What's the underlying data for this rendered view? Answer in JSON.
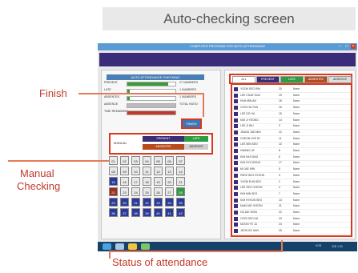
{
  "banner": {
    "title": "Auto-checking screen"
  },
  "annotations": {
    "finish": "Finish",
    "manual_line1": "Manual",
    "manual_line2": "Checking",
    "status": "Status of attendance"
  },
  "app": {
    "window_title": "COMPUTER PROGRAM FOR AUTO-ATTENDANCE",
    "left_panel_title": "AUTO ATTENDANCE CHECKING",
    "stats": [
      {
        "label": "PRESENT",
        "progress": 0.85,
        "value": "27 NUMBERS",
        "color": "#3a9c3a"
      },
      {
        "label": "LATE",
        "progress": 0.05,
        "value": "1 NUMBERS",
        "color": "#3a9c3a"
      },
      {
        "label": "ABSENTEE",
        "progress": 0.05,
        "value": "1 NUMBERS",
        "color": "#3a9c3a"
      },
      {
        "label": "ABSENCE",
        "progress": 1.0,
        "value": "TOTAL RATIO",
        "color": "#bbbbbb"
      },
      {
        "label": "TIME REMAINING",
        "progress": 1.0,
        "value": "",
        "color": "#c0392b"
      }
    ],
    "finish_button": "FINISH",
    "manual": {
      "label": "MANUAL",
      "buttons": [
        {
          "label": "PRESENT",
          "color": "#3b2c7a"
        },
        {
          "label": "LATE",
          "color": "#2e9d42"
        },
        {
          "label": "ABSENTEE",
          "color": "#b84a1e"
        },
        {
          "label": "ABSENCE",
          "color": "#cfcfcf"
        }
      ]
    },
    "seats": [
      [
        "01",
        "02",
        "03",
        "04",
        "05",
        "06",
        "07"
      ],
      [
        "08",
        "09",
        "10",
        "11",
        "12",
        "13",
        "14"
      ],
      [
        "15",
        "16",
        "17",
        "18",
        "19",
        "20",
        "21"
      ],
      [
        "22",
        "23",
        "24",
        "25",
        "26",
        "27",
        "28"
      ],
      [
        "29",
        "30",
        "31",
        "32",
        "33",
        "34",
        "35"
      ],
      [
        "36",
        "37",
        "38",
        "39",
        "40",
        "41",
        "42"
      ]
    ],
    "tabs": [
      {
        "label": "ALL",
        "color": "#ffffff",
        "text": "#333333"
      },
      {
        "label": "PRESENT",
        "color": "#3b2c7a",
        "text": "#ffffff"
      },
      {
        "label": "LATE",
        "color": "#2e9d42",
        "text": "#ffffff"
      },
      {
        "label": "ABSENTEE",
        "color": "#b84a1e",
        "text": "#ffffff"
      },
      {
        "label": "ABSENCE",
        "color": "#dddddd",
        "text": "#333333"
      }
    ],
    "attendance": [
      {
        "name": "YOON SEO RIN",
        "id": "20",
        "status": "None"
      },
      {
        "name": "LEE CHAE EUN",
        "id": "19",
        "status": "None"
      },
      {
        "name": "HUH MIN AH",
        "id": "18",
        "status": "None"
      },
      {
        "name": "CHOI HA YUN",
        "id": "16",
        "status": "None"
      },
      {
        "name": "LEE DO HA",
        "id": "15",
        "status": "None"
      },
      {
        "name": "KIM JI YEONG",
        "id": "14",
        "status": "None"
      },
      {
        "name": "LEE JI WU",
        "id": "9",
        "status": "None"
      },
      {
        "name": "JEANG JAE MIN",
        "id": "12",
        "status": "None"
      },
      {
        "name": "CHEON HYE RI",
        "id": "11",
        "status": "None"
      },
      {
        "name": "LEE MIN SEO",
        "id": "10",
        "status": "None"
      },
      {
        "name": "HWANG JE",
        "id": "8",
        "status": "None"
      },
      {
        "name": "KIM HA EUNG",
        "id": "6",
        "status": "None"
      },
      {
        "name": "KIM HYO BONG",
        "id": "17",
        "status": "None"
      },
      {
        "name": "MI JAE MIN",
        "id": "5",
        "status": "None"
      },
      {
        "name": "PARK SEO HYEON",
        "id": "3",
        "status": "None"
      },
      {
        "name": "YOON EUN SEO",
        "id": "2",
        "status": "None"
      },
      {
        "name": "LEE SEO HYEON",
        "id": "4",
        "status": "None"
      },
      {
        "name": "KIM MIN SEO",
        "id": "7",
        "status": "None"
      },
      {
        "name": "KIM HYEON SEO",
        "id": "13",
        "status": "None"
      },
      {
        "name": "NAM JAE HYEON",
        "id": "21",
        "status": "None"
      },
      {
        "name": "HA JAE WON",
        "id": "22",
        "status": "None"
      },
      {
        "name": "CHOI SEO HA",
        "id": "23",
        "status": "None"
      },
      {
        "name": "MOON YE JU",
        "id": "24",
        "status": "None"
      },
      {
        "name": "JEON SO HAN",
        "id": "25",
        "status": "None"
      }
    ],
    "taskbar": {
      "lang": "KOR",
      "time": "오후 1:30"
    }
  }
}
